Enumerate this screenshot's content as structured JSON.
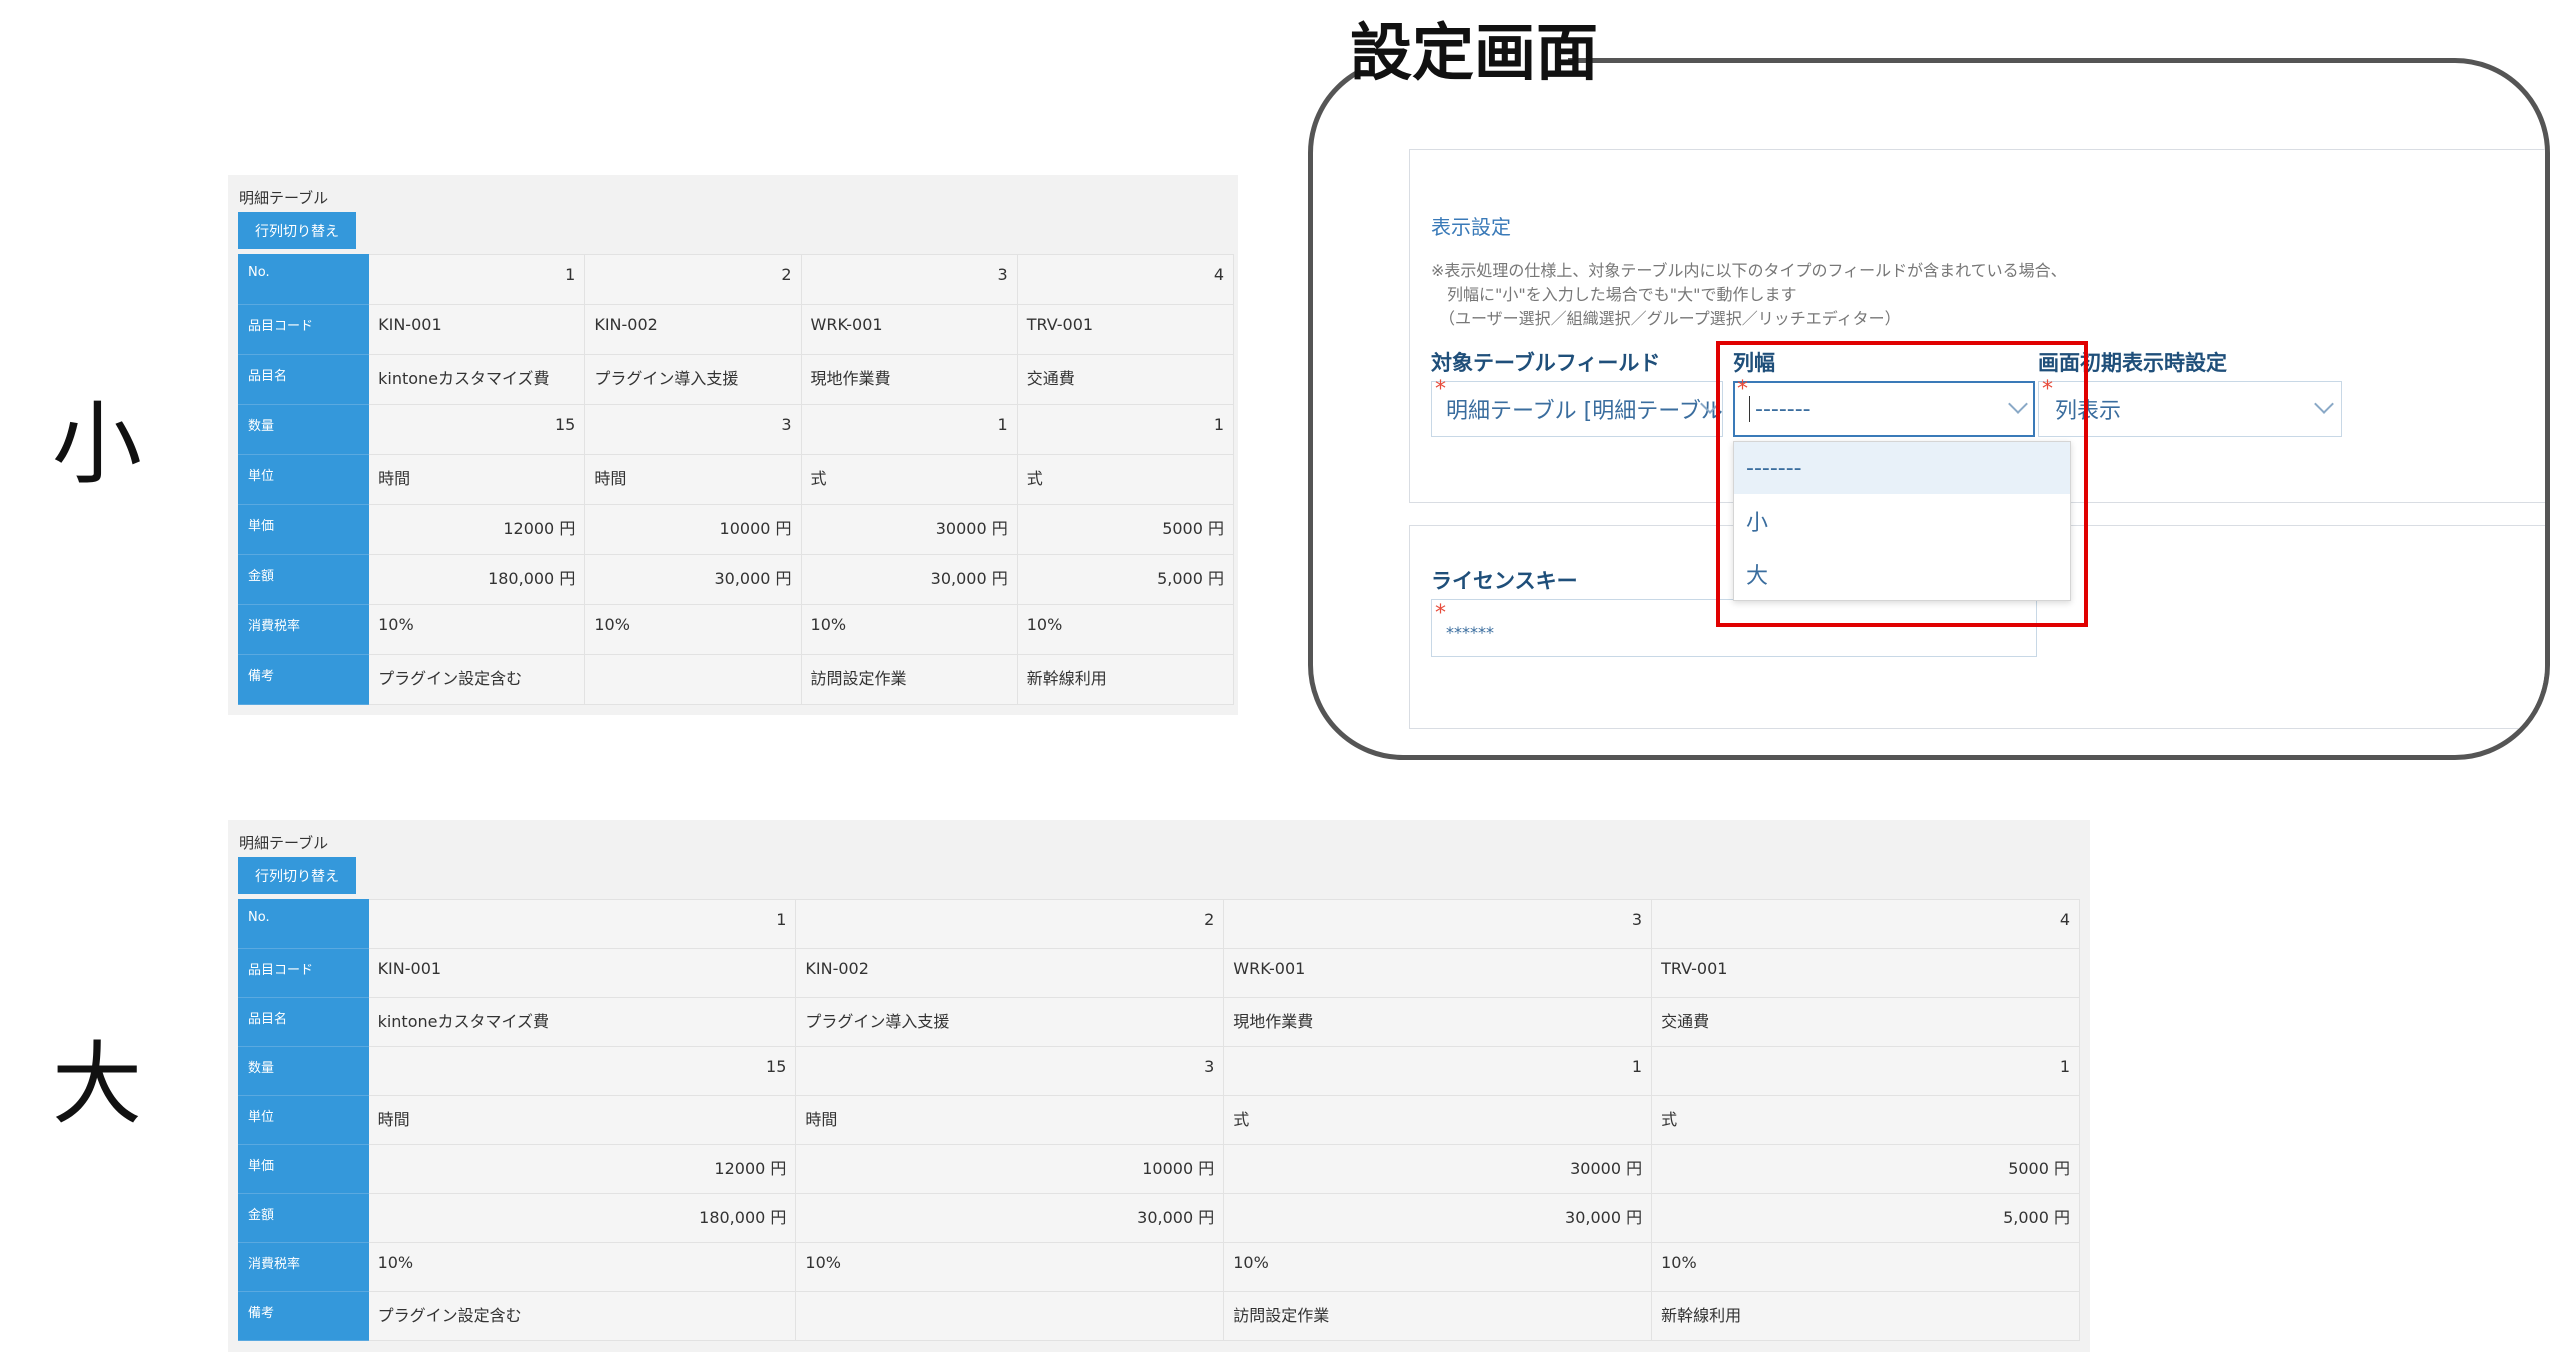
{
  "labels": {
    "small": "小",
    "large": "大",
    "panel_title": "設定画面"
  },
  "table_widget": {
    "label": "明細テーブル",
    "toggle_button": "行列切り替え",
    "row_headers": [
      "No.",
      "品目コード",
      "品目名",
      "数量",
      "単位",
      "単価",
      "金額",
      "消費税率",
      "備考"
    ],
    "columns": [
      [
        "1",
        "KIN-001",
        "kintoneカスタマイズ費",
        "15",
        "時間",
        "12000 円",
        "180,000 円",
        "10%",
        "プラグイン設定含む"
      ],
      [
        "2",
        "KIN-002",
        "プラグイン導入支援",
        "3",
        "時間",
        "10000 円",
        "30,000 円",
        "10%",
        ""
      ],
      [
        "3",
        "WRK-001",
        "現地作業費",
        "1",
        "式",
        "30000 円",
        "30,000 円",
        "10%",
        "訪問設定作業"
      ],
      [
        "4",
        "TRV-001",
        "交通費",
        "1",
        "式",
        "5000 円",
        "5,000 円",
        "10%",
        "新幹線利用"
      ]
    ],
    "numeric_rows": [
      0,
      3,
      5,
      6
    ]
  },
  "settings": {
    "section_title": "表示設定",
    "note_lines": [
      "※表示処理の仕様上、対象テーブル内に以下のタイプのフィールドが含まれている場合、",
      "　列幅に\"小\"を入力した場合でも\"大\"で動作します",
      "　（ユーザー選択／組織選択／グループ選択／リッチエディター）"
    ],
    "target_label": "対象テーブルフィールド",
    "target_value": "明細テーブル [明細テーブル]",
    "width_label": "列幅",
    "width_value": "-------",
    "initial_label": "画面初期表示時設定",
    "initial_value": "列表示",
    "required_mark": "*",
    "dropdown_options": [
      "-------",
      "小",
      "大"
    ],
    "license_label": "ライセンスキー",
    "license_value": "******"
  }
}
